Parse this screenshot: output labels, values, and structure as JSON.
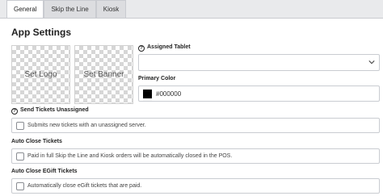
{
  "tabs": [
    {
      "label": "General"
    },
    {
      "label": "Skip the Line"
    },
    {
      "label": "Kiosk"
    }
  ],
  "page_title": "App Settings",
  "logo_placeholder": "Set Logo",
  "banner_placeholder": "Set Banner",
  "assigned_tablet": {
    "label": "Assigned Tablet",
    "value": ""
  },
  "primary_color": {
    "label": "Primary Color",
    "value": "#000000",
    "swatch": "#000000"
  },
  "send_unassigned": {
    "label": "Send Tickets Unassigned",
    "option": "Submits new tickets with an unassigned server.",
    "checked": false
  },
  "auto_close": {
    "label": "Auto Close Tickets",
    "option": "Paid in full Skip the Line and Kiosk orders will be automatically closed in the POS.",
    "checked": false
  },
  "auto_close_egift": {
    "label": "Auto Close EGift Tickets",
    "option": "Automatically close eGift tickets that are paid.",
    "checked": false
  }
}
